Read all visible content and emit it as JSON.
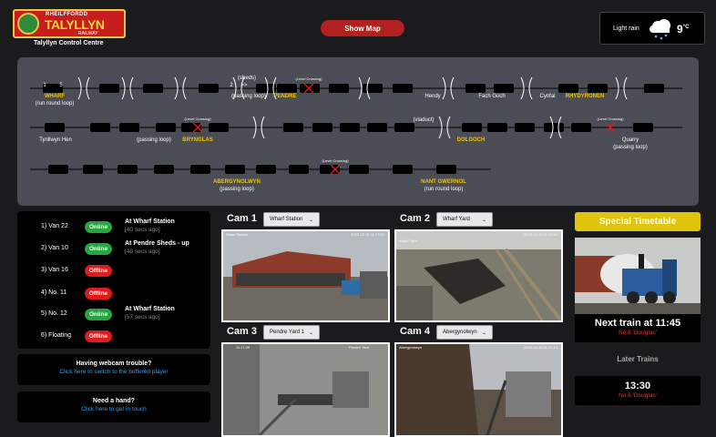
{
  "header": {
    "logo_line1": "RHEILFFORDD",
    "logo_line2": "TALYLLYN",
    "logo_line3": "RAILWAY",
    "subtitle": "Talyllyn Control Centre",
    "show_map_label": "Show Map"
  },
  "weather": {
    "condition": "Light rain",
    "temp": "9",
    "unit": "°C",
    "icon": "cloud-rain-icon"
  },
  "track_map": {
    "sections": {
      "wharf_num1": "1",
      "wharf_num2": "5",
      "pendre_num1": "2",
      "pendre_num2": ">>"
    },
    "labels": {
      "wharf": "WHARF",
      "wharf_note": "(run round loop)",
      "sheds": "(sheds)",
      "pendre_loop": "(passing loop)",
      "pendre": "PENDRE",
      "level_crossing": "(Level Crossing)",
      "hendy": "Hendy",
      "fach_goch": "Fach Goch",
      "cynfal": "Cynfal",
      "rhydyronen": "RHYDYRONEN",
      "tynllwyn_hen": "Tynllwyn Hen",
      "brynglas_loop": "(passing loop)",
      "brynglas": "BRYNGLAS",
      "viaduct": "(viaduct)",
      "dolgoch": "DOLGOCH",
      "quarry": "Quarry",
      "quarry_loop": "(passing loop)",
      "abergynolwyn": "ABERGYNOLWYN",
      "abergynolwyn_loop": "(passing loop)",
      "nant_gwernol": "NANT GWERNOL",
      "nant_gwernol_note": "(run round loop)"
    }
  },
  "vehicles": [
    {
      "name": "1) Van 22",
      "status": "Online",
      "location": "At Wharf Station",
      "ago": "[40 secs ago]"
    },
    {
      "name": "2) Van 10",
      "status": "Online",
      "location": "At Pendre Sheds - up",
      "ago": "[48 secs ago]"
    },
    {
      "name": "3) Van 16",
      "status": "Offline",
      "location": "",
      "ago": ""
    },
    {
      "name": "4) No. 11",
      "status": "Offline",
      "location": "",
      "ago": ""
    },
    {
      "name": "5) No. 12",
      "status": "Online",
      "location": "At Wharf Station",
      "ago": "[57 secs ago]"
    },
    {
      "name": "6) Floating",
      "status": "Offline",
      "location": "",
      "ago": ""
    }
  ],
  "help": {
    "webcam_title": "Having webcam trouble?",
    "webcam_link": "Click here to switch to the buffered player",
    "hand_title": "Need a hand?",
    "hand_link": "Click here to get in touch"
  },
  "cams": [
    {
      "title": "Cam 1",
      "selected": "Wharf Station",
      "overlay": "Wharf Station",
      "stamp": "2023-12-16 11:17:21"
    },
    {
      "title": "Cam 2",
      "selected": "Wharf Yard",
      "overlay": "Wharf Yard",
      "stamp": "2023-12-16 11:17:21"
    },
    {
      "title": "Cam 3",
      "selected": "Pendre Yard 1",
      "overlay": "Pendre Yard",
      "stamp": "11:17:29"
    },
    {
      "title": "Cam 4",
      "selected": "Abergynolwyn",
      "overlay": "Abergynolwyn",
      "stamp": "2023-12-16 11:17:13"
    }
  ],
  "timetable": {
    "special_label": "Special Timetable",
    "next_title": "Next train at 11:45",
    "next_loco": "No.6 'Douglas'",
    "later_title": "Later Trains",
    "later_time": "13:30",
    "later_loco": "No.6 'Douglas'"
  },
  "colors": {
    "online": "#26a541",
    "offline": "#e01b1b",
    "station": "#f5c400",
    "accent": "#b32020",
    "link": "#2ea3f2"
  }
}
